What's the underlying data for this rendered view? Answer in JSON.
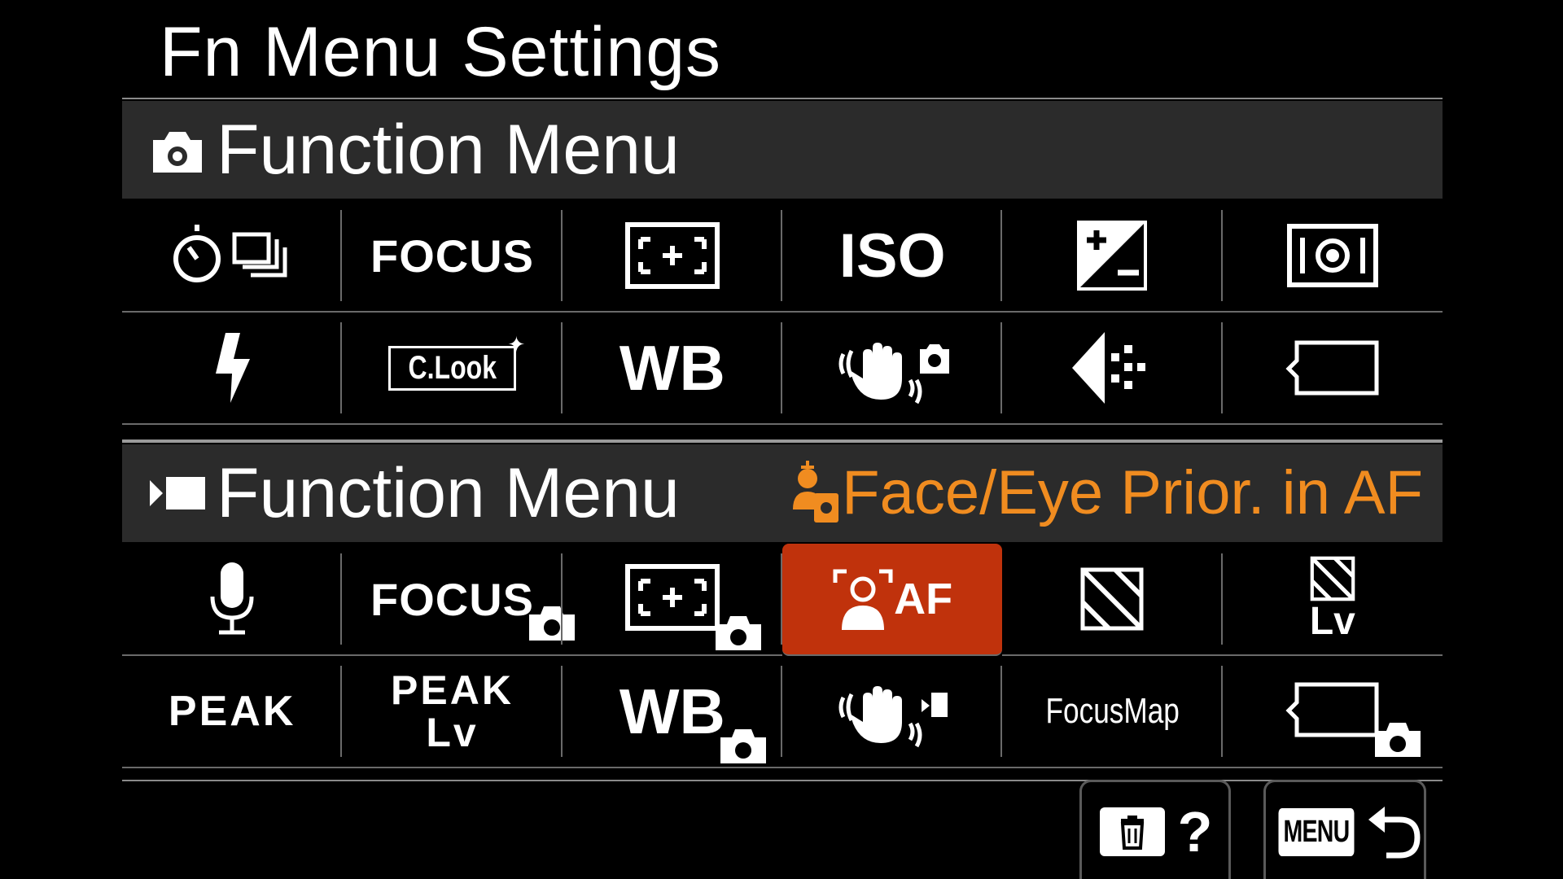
{
  "page_title": "Fn Menu Settings",
  "still_section": {
    "header_label": "Function Menu",
    "header_icon": "camera-icon",
    "rows": [
      [
        {
          "name": "drive-mode-icon",
          "text": ""
        },
        {
          "name": "focus-mode-icon",
          "text": "FOCUS"
        },
        {
          "name": "focus-area-icon",
          "text": ""
        },
        {
          "name": "iso-icon",
          "text": "ISO"
        },
        {
          "name": "exposure-comp-icon",
          "text": ""
        },
        {
          "name": "metering-mode-icon",
          "text": ""
        }
      ],
      [
        {
          "name": "flash-mode-icon",
          "text": ""
        },
        {
          "name": "creative-look-icon",
          "text": "C.Look"
        },
        {
          "name": "white-balance-icon",
          "text": "WB"
        },
        {
          "name": "steadyshot-icon",
          "text": ""
        },
        {
          "name": "image-quality-icon",
          "text": ""
        },
        {
          "name": "empty-slot-icon",
          "text": ""
        }
      ]
    ]
  },
  "movie_section": {
    "header_label": "Function Menu",
    "header_icon": "movie-icon",
    "selected_item_label": "Face/Eye Prior. in AF",
    "selected_item_icon": "face-eye-still-icon",
    "rows": [
      [
        {
          "name": "audio-rec-icon",
          "text": ""
        },
        {
          "name": "focus-mode-still-icon",
          "text": "FOCUS"
        },
        {
          "name": "focus-area-still-icon",
          "text": ""
        },
        {
          "name": "face-eye-af-icon",
          "text": "AF"
        },
        {
          "name": "zebra-icon",
          "text": ""
        },
        {
          "name": "zebra-lv-icon",
          "text": "Lv"
        }
      ],
      [
        {
          "name": "peaking-icon",
          "text": "PEAK"
        },
        {
          "name": "peaking-lv-icon",
          "text": "PEAK",
          "text2": "Lv"
        },
        {
          "name": "white-balance-still-icon",
          "text": "WB"
        },
        {
          "name": "steadyshot-movie-icon",
          "text": ""
        },
        {
          "name": "focus-map-icon",
          "text": "FocusMap"
        },
        {
          "name": "empty-slot-still-icon",
          "text": ""
        }
      ]
    ]
  },
  "footer": {
    "delete_help_label": "?",
    "menu_label": "MENU"
  },
  "colors": {
    "accent": "#f08c20",
    "selected_bg": "#c0320c",
    "header_bg": "#2b2b2b"
  }
}
